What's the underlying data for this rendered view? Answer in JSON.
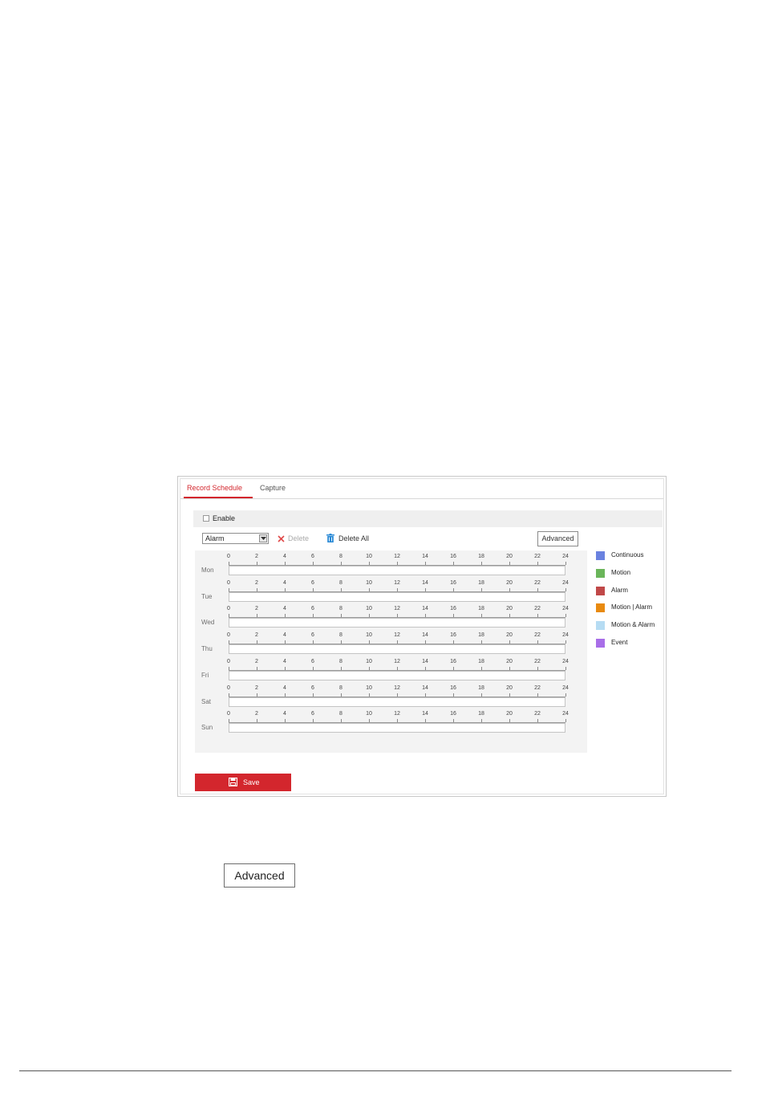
{
  "tabs": [
    {
      "label": "Record Schedule"
    },
    {
      "label": "Capture"
    }
  ],
  "enable_label": "Enable",
  "record_type": {
    "selected": "Alarm"
  },
  "toolbar": {
    "delete_label": "Delete",
    "delete_all_label": "Delete All",
    "advanced_label": "Advanced"
  },
  "schedule": {
    "days": [
      "Mon",
      "Tue",
      "Wed",
      "Thu",
      "Fri",
      "Sat",
      "Sun"
    ],
    "ticks": [
      "0",
      "2",
      "4",
      "6",
      "8",
      "10",
      "12",
      "14",
      "16",
      "18",
      "20",
      "22",
      "24"
    ]
  },
  "legend": [
    {
      "label": "Continuous",
      "color": "#6a82e0"
    },
    {
      "label": "Motion",
      "color": "#6ab55a"
    },
    {
      "label": "Alarm",
      "color": "#c04848"
    },
    {
      "label": "Motion | Alarm",
      "color": "#e88a10"
    },
    {
      "label": "Motion & Alarm",
      "color": "#b6dcf3"
    },
    {
      "label": "Event",
      "color": "#a86ee8"
    }
  ],
  "save_label": "Save",
  "advanced_button_label": "Advanced",
  "colors": {
    "accent": "#d3262d"
  }
}
